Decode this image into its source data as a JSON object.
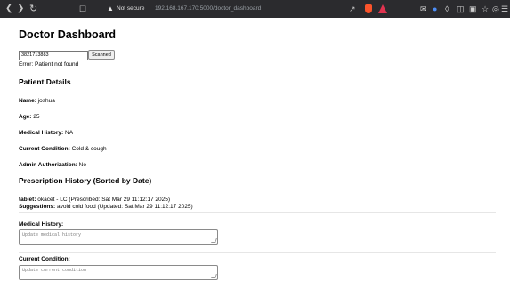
{
  "browser": {
    "security_label": "Not secure",
    "url": "192.168.167.170:5000/doctor_dashboard"
  },
  "page": {
    "title": "Doctor Dashboard"
  },
  "scan": {
    "input_value": "3821713883",
    "button_label": "Scanned",
    "error_text": "Error: Patient not found"
  },
  "patient": {
    "heading": "Patient Details",
    "fields": [
      {
        "label": "Name:",
        "value": " joshua"
      },
      {
        "label": "Age:",
        "value": " 25"
      },
      {
        "label": "Medical History:",
        "value": " NA"
      },
      {
        "label": "Current Condition:",
        "value": " Cold & cough"
      },
      {
        "label": "Admin Authorization:",
        "value": " No"
      }
    ]
  },
  "history": {
    "heading": "Prescription History (Sorted by Date)",
    "items": [
      {
        "tablet_label": "tablet:",
        "tablet_value": " okacet - LC (Prescribed: Sat Mar 29 11:12:17 2025)",
        "suggestions_label": "Suggestions:",
        "suggestions_value": " avoid cold food (Updated: Sat Mar 29 11:12:17 2025)"
      }
    ]
  },
  "update": {
    "medical_history_label": "Medical History:",
    "medical_history_placeholder": "Update medical history",
    "current_condition_label": "Current Condition:",
    "current_condition_placeholder": "Update current condition"
  }
}
